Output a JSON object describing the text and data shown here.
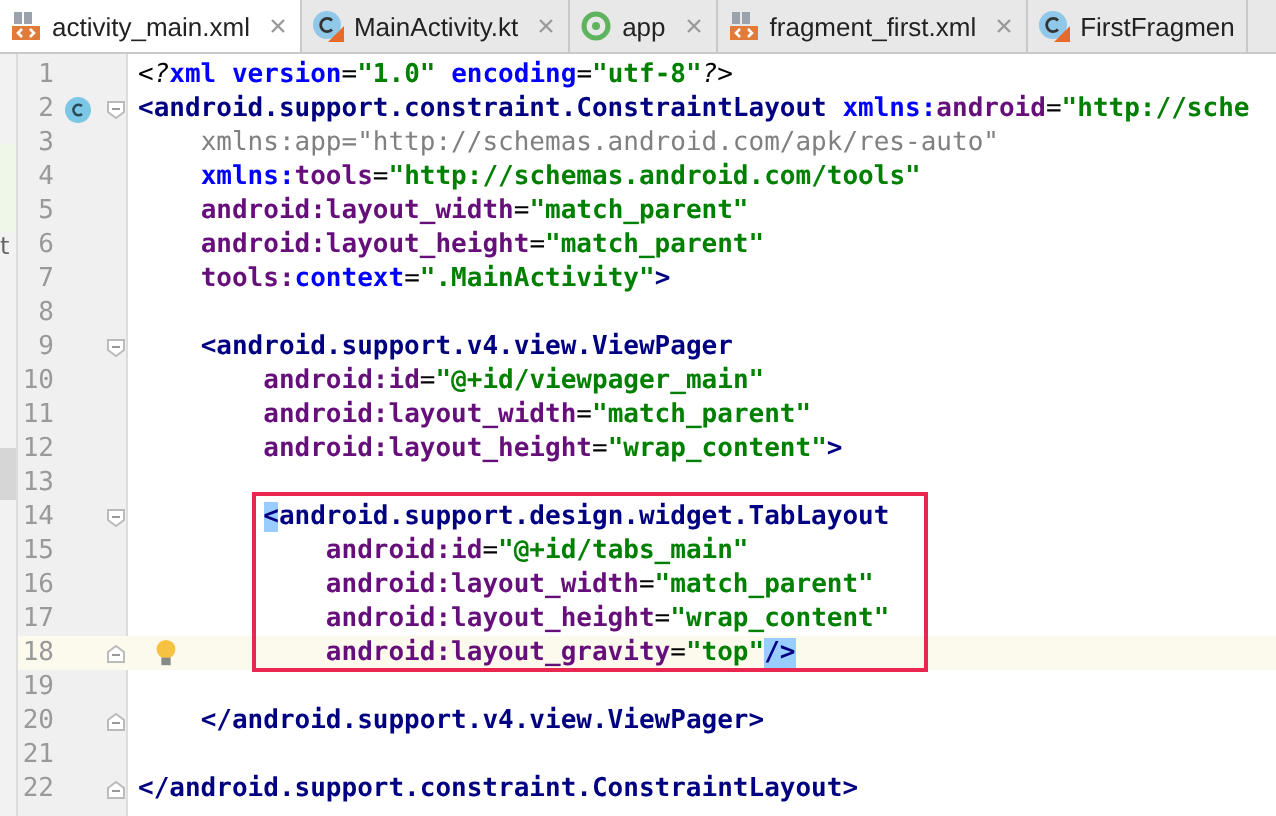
{
  "tabs": [
    {
      "label": "activity_main.xml",
      "kind": "xml",
      "selected": true,
      "closable": true
    },
    {
      "label": "MainActivity.kt",
      "kind": "kotlin",
      "selected": false,
      "closable": true
    },
    {
      "label": "app",
      "kind": "module",
      "selected": false,
      "closable": true
    },
    {
      "label": "fragment_first.xml",
      "kind": "xml",
      "selected": false,
      "closable": true
    },
    {
      "label": "FirstFragmen",
      "kind": "kotlin",
      "selected": false,
      "closable": false
    }
  ],
  "side_panel": {
    "text": "t"
  },
  "editor": {
    "lines": [
      {
        "number": "1",
        "tokens": [
          {
            "kind": "punct",
            "text": "<?"
          },
          {
            "kind": "key",
            "text": "xml"
          },
          {
            "kind": "key",
            "text": " version"
          },
          {
            "kind": "punct",
            "text": "="
          },
          {
            "kind": "value",
            "text": "\"1.0\""
          },
          {
            "kind": "key",
            "text": " encoding"
          },
          {
            "kind": "punct",
            "text": "="
          },
          {
            "kind": "value",
            "text": "\"utf-8\""
          },
          {
            "kind": "punct",
            "text": "?>"
          }
        ]
      },
      {
        "number": "2",
        "class_marker": true,
        "fold_start": true,
        "tokens": [
          {
            "kind": "tag",
            "text": "<android.support.constraint.ConstraintLayout"
          },
          {
            "kind": "key",
            "text": " xmlns:"
          },
          {
            "kind": "ns",
            "text": "android"
          },
          {
            "kind": "punct",
            "text": "="
          },
          {
            "kind": "value",
            "text": "\"http://sche"
          }
        ]
      },
      {
        "number": "3",
        "tokens": [
          {
            "kind": "unused",
            "text": "    xmlns:app=\"http://schemas.android.com/apk/res-auto\""
          }
        ]
      },
      {
        "number": "4",
        "tokens": [
          {
            "kind": "key",
            "text": "    xmlns:"
          },
          {
            "kind": "ns",
            "text": "tools"
          },
          {
            "kind": "punct",
            "text": "="
          },
          {
            "kind": "value",
            "text": "\"http://schemas.android.com/tools\""
          }
        ]
      },
      {
        "number": "5",
        "tokens": [
          {
            "kind": "ns",
            "text": "    android:layout_width"
          },
          {
            "kind": "punct",
            "text": "="
          },
          {
            "kind": "value",
            "text": "\"match_parent\""
          }
        ]
      },
      {
        "number": "6",
        "tokens": [
          {
            "kind": "ns",
            "text": "    android:layout_height"
          },
          {
            "kind": "punct",
            "text": "="
          },
          {
            "kind": "value",
            "text": "\"match_parent\""
          }
        ]
      },
      {
        "number": "7",
        "tokens": [
          {
            "kind": "ns",
            "text": "    tools:"
          },
          {
            "kind": "key",
            "text": "context"
          },
          {
            "kind": "punct",
            "text": "="
          },
          {
            "kind": "value",
            "text": "\".MainActivity\""
          },
          {
            "kind": "tag",
            "text": ">"
          }
        ]
      },
      {
        "number": "8"
      },
      {
        "number": "9",
        "fold_start": true,
        "tokens": [
          {
            "kind": "tag",
            "text": "    <android.support.v4.view.ViewPager"
          }
        ]
      },
      {
        "number": "10",
        "tokens": [
          {
            "kind": "ns",
            "text": "        android:id"
          },
          {
            "kind": "punct",
            "text": "="
          },
          {
            "kind": "value",
            "text": "\"@+id/viewpager_main\""
          }
        ]
      },
      {
        "number": "11",
        "tokens": [
          {
            "kind": "ns",
            "text": "        android:layout_width"
          },
          {
            "kind": "punct",
            "text": "="
          },
          {
            "kind": "value",
            "text": "\"match_parent\""
          }
        ]
      },
      {
        "number": "12",
        "tokens": [
          {
            "kind": "ns",
            "text": "        android:layout_height"
          },
          {
            "kind": "punct",
            "text": "="
          },
          {
            "kind": "value",
            "text": "\"wrap_content\""
          },
          {
            "kind": "tag",
            "text": ">"
          }
        ]
      },
      {
        "number": "13"
      },
      {
        "number": "14",
        "fold_start": true,
        "boxed": true,
        "tokens": [
          {
            "kind": "match",
            "text": "        <"
          },
          {
            "kind": "tag",
            "text": "android.support.design.widget.TabLayout"
          }
        ]
      },
      {
        "number": "15",
        "boxed": true,
        "tokens": [
          {
            "kind": "ns",
            "text": "            android:id"
          },
          {
            "kind": "punct",
            "text": "="
          },
          {
            "kind": "value",
            "text": "\"@+id/tabs_main\""
          }
        ]
      },
      {
        "number": "16",
        "boxed": true,
        "tokens": [
          {
            "kind": "ns",
            "text": "            android:layout_width"
          },
          {
            "kind": "punct",
            "text": "="
          },
          {
            "kind": "value",
            "text": "\"match_parent\""
          }
        ]
      },
      {
        "number": "17",
        "boxed": true,
        "tokens": [
          {
            "kind": "ns",
            "text": "            android:layout_height"
          },
          {
            "kind": "punct",
            "text": "="
          },
          {
            "kind": "value",
            "text": "\"wrap_content\""
          }
        ]
      },
      {
        "number": "18",
        "fold_end": true,
        "boxed": true,
        "current": true,
        "bulb": true,
        "tokens": [
          {
            "kind": "ns",
            "text": "            android:layout_gravity"
          },
          {
            "kind": "punct",
            "text": "="
          },
          {
            "kind": "value",
            "text": "\"top\""
          },
          {
            "kind": "match",
            "text": "/>"
          }
        ]
      },
      {
        "number": "19"
      },
      {
        "number": "20",
        "fold_end": true,
        "tokens": [
          {
            "kind": "tag",
            "text": "    </android.support.v4.view.ViewPager>"
          }
        ]
      },
      {
        "number": "21"
      },
      {
        "number": "22",
        "fold_end": true,
        "tokens": [
          {
            "kind": "tag",
            "text": "</android.support.constraint.ConstraintLayout>"
          }
        ]
      }
    ]
  }
}
